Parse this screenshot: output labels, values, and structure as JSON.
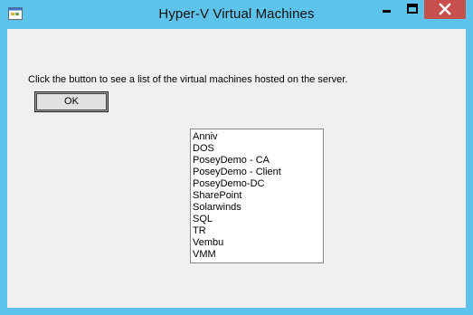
{
  "window": {
    "title": "Hyper-V Virtual Machines",
    "controls": [
      "minimize-icon",
      "maximize-icon",
      "close-icon"
    ],
    "title_bar_color": "#5ec3ea",
    "close_button_color": "#c7504f"
  },
  "form": {
    "prompt": "Click the button to see a list of the virtual machines hosted on the server.",
    "ok_label": "OK",
    "background": "#f0f0f0"
  },
  "vm_list": {
    "items": [
      "Anniv",
      "DOS",
      "PoseyDemo - CA",
      "PoseyDemo - Client",
      "PoseyDemo-DC",
      "SharePoint",
      "Solarwinds",
      "SQL",
      "TR",
      "Vembu",
      "VMM"
    ]
  }
}
